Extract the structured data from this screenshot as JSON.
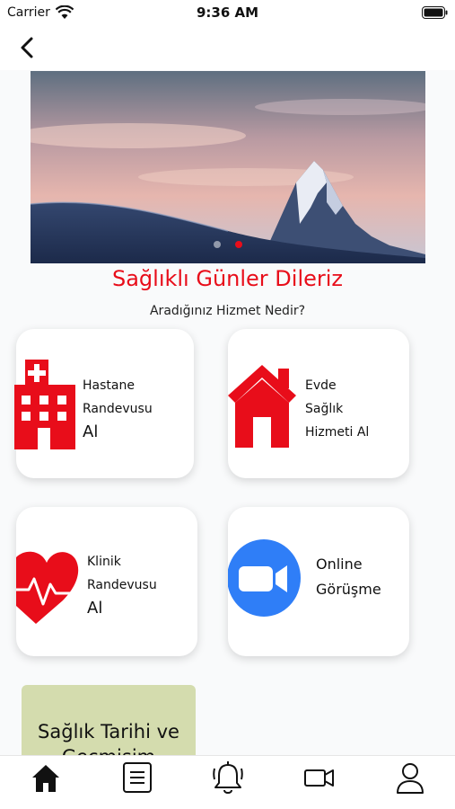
{
  "status_bar": {
    "carrier": "Carrier",
    "time": "9:36 AM"
  },
  "nav": {
    "back_icon": "chevron-left-icon"
  },
  "banner": {
    "slides": 2,
    "active_slide": 2,
    "accent_color": "#e80d1a"
  },
  "greeting": "Sağlıklı Günler Dileriz",
  "question": "Aradığınız Hizmet Nedir?",
  "services": [
    {
      "line1": "Hastane",
      "line2": "Randevusu",
      "line3": "Al",
      "icon": "hospital-icon"
    },
    {
      "line1": "Evde",
      "line2": "Sağlık",
      "line3": "Hizmeti Al",
      "icon": "house-icon"
    },
    {
      "line1": "Klinik",
      "line2": "Randevusu",
      "line3": "Al",
      "icon": "heart-pulse-icon"
    },
    {
      "line1": "Online",
      "line2": "Görüşme",
      "icon": "video-call-icon"
    }
  ],
  "history_card": {
    "line1": "Sağlık Tarihi ve",
    "line2": "Geçmişim"
  },
  "tab_bar": {
    "items": [
      "home-icon",
      "document-list-icon",
      "bell-icon",
      "video-camera-icon",
      "profile-icon"
    ],
    "active": "home-icon"
  },
  "colors": {
    "accent": "#e80d1a",
    "zoom_blue": "#2f7ef7",
    "history_bg": "#d4dcae"
  }
}
